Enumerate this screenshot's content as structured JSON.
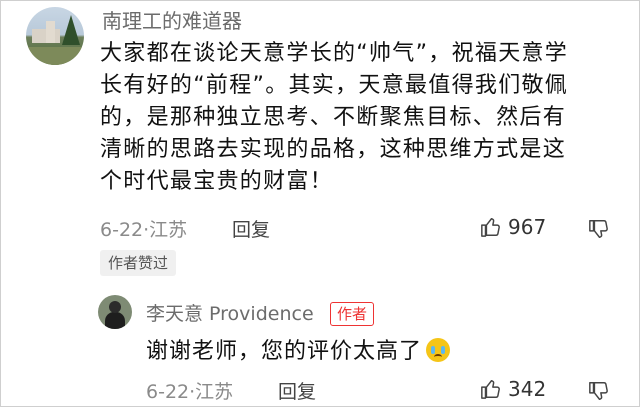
{
  "comment": {
    "username": "南理工的难道器",
    "text": "大家都在谈论天意学长的“帅气”，祝福天意学长有好的“前程”。其实，天意最值得我们敬佩的，是那种独立思考、不断聚焦目标、然后有清晰的思路去实现的品格，这种思维方式是这个时代最宝贵的财富！",
    "lines": [
      "大家都在谈论天意学长的“帅气”，祝福天意学",
      "长有好的“前程”。其实，天意最值得我们敬佩",
      "的，是那种独立思考、不断聚焦目标、然后有",
      "清晰的思路去实现的品格，这种思维方式是这",
      "个时代最宝贵的财富！"
    ],
    "date_location": "6-22·江苏",
    "reply_label": "回复",
    "likes": "967",
    "author_liked_badge": "作者赞过",
    "icons": {
      "like": "thumbs-up-icon",
      "dislike": "thumbs-down-icon"
    }
  },
  "reply": {
    "username": "李天意 Providence",
    "author_badge": "作者",
    "text": "谢谢老师，您的评价太高了",
    "emoji": "crying-face-emoji",
    "date_location": "6-22·江苏",
    "reply_label": "回复",
    "likes": "342",
    "icons": {
      "like": "thumbs-up-icon",
      "dislike": "thumbs-down-icon"
    }
  },
  "colors": {
    "author_badge": "#e33333",
    "meta_text": "#8a8a8a",
    "emoji": "#f5c518"
  }
}
